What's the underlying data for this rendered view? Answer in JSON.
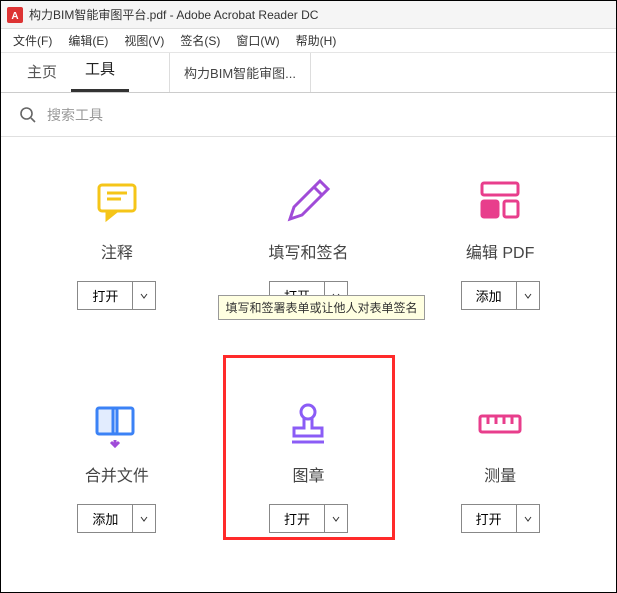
{
  "window": {
    "title": "构力BIM智能审图平台.pdf - Adobe Acrobat Reader DC"
  },
  "menubar": {
    "file": "文件(F)",
    "edit": "编辑(E)",
    "view": "视图(V)",
    "sign": "签名(S)",
    "window": "窗口(W)",
    "help": "帮助(H)"
  },
  "tabs": {
    "home": "主页",
    "tools": "工具",
    "doc": "构力BIM智能审图..."
  },
  "search": {
    "placeholder": "搜索工具"
  },
  "tools_grid": {
    "comment": {
      "label": "注释",
      "action": "打开"
    },
    "fillsign": {
      "label": "填写和签名",
      "action": "打开"
    },
    "editpdf": {
      "label": "编辑 PDF",
      "action": "添加"
    },
    "combine": {
      "label": "合并文件",
      "action": "添加"
    },
    "stamp": {
      "label": "图章",
      "action": "打开"
    },
    "measure": {
      "label": "测量",
      "action": "打开"
    }
  },
  "tooltip": {
    "fillsign": "填写和签署表单或让他人对表单签名"
  }
}
